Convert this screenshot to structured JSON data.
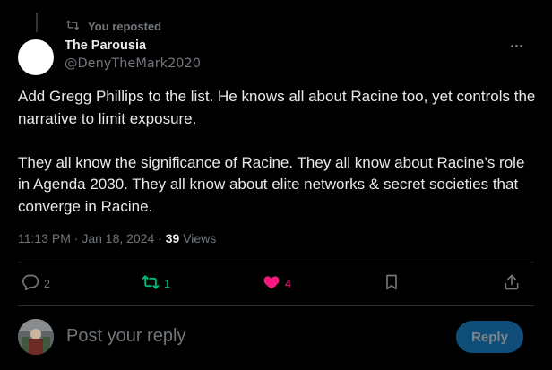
{
  "repost_banner": {
    "icon": "repost-icon",
    "text": "You reposted"
  },
  "author": {
    "name": "The Parousia",
    "handle": "@DenyTheMark2020"
  },
  "post": {
    "text": "Add Gregg Phillips to the list. He knows all about Racine too, yet controls the narrative to limit exposure.\n\nThey all know the significance of Racine. They all know about Racine’s role in Agenda 2030. They all know about elite networks & secret societies that converge in Racine."
  },
  "meta": {
    "timestamp": "11:13 PM · Jan 18, 2024 · ",
    "views_count": "39",
    "views_label": " Views"
  },
  "actions": {
    "replies": "2",
    "reposts": "1",
    "likes": "4"
  },
  "reply_box": {
    "placeholder": "Post your reply",
    "button_label": "Reply"
  },
  "colors": {
    "background": "#000000",
    "text": "#e7e9ea",
    "muted": "#71767b",
    "repost_active": "#00ba7c",
    "like_active": "#f91880",
    "reply_button_bg": "#0f4e78"
  }
}
